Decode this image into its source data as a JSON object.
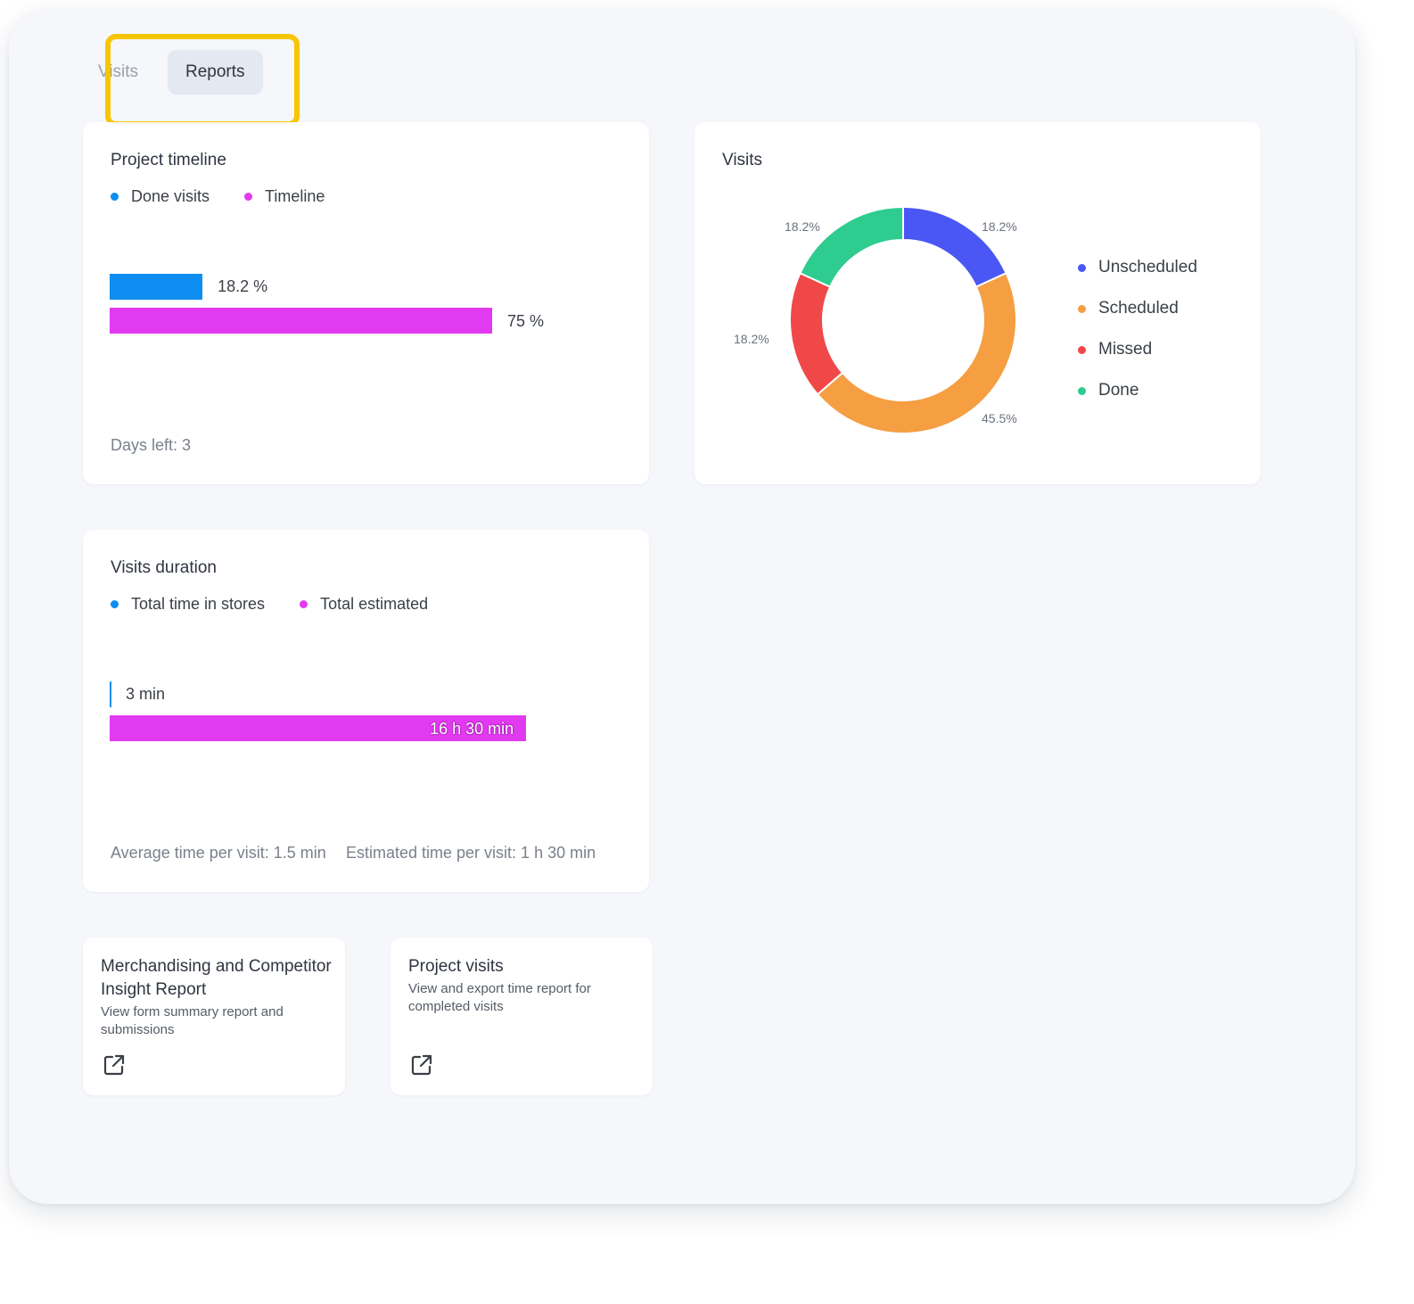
{
  "tabs": [
    {
      "label": "Visits",
      "active": false
    },
    {
      "label": "Reports",
      "active": true
    }
  ],
  "project_timeline": {
    "title": "Project timeline",
    "legend": [
      {
        "label": "Done visits",
        "color": "#0d8ef0"
      },
      {
        "label": "Timeline",
        "color": "#e23af0"
      }
    ],
    "bars": [
      {
        "label": "18.2 %",
        "value": 18.2,
        "color": "#0d8ef0"
      },
      {
        "label": "75 %",
        "value": 75,
        "color": "#e23af0"
      }
    ],
    "footer": "Days left: 3"
  },
  "visits": {
    "title": "Visits",
    "legend": [
      {
        "label": "Unscheduled",
        "color": "#4a57f5"
      },
      {
        "label": "Scheduled",
        "color": "#f59e42"
      },
      {
        "label": "Missed",
        "color": "#f04848"
      },
      {
        "label": "Done",
        "color": "#2ecc8f"
      }
    ]
  },
  "visits_duration": {
    "title": "Visits duration",
    "legend": [
      {
        "label": "Total time in stores",
        "color": "#0d8ef0"
      },
      {
        "label": "Total estimated",
        "color": "#e23af0"
      }
    ],
    "bars": [
      {
        "label": "3 min",
        "value": 3,
        "color": "#0d8ef0"
      },
      {
        "label": "16 h 30 min",
        "value": 990,
        "color": "#e23af0"
      }
    ],
    "footer_avg": "Average time per visit: 1.5 min",
    "footer_est": "Estimated time per visit: 1 h 30 min"
  },
  "reports": [
    {
      "title": "Merchandising and Competitor Insight Report",
      "description": "View form summary report and submissions",
      "icon": "external-link-icon"
    },
    {
      "title": "Project visits",
      "description": "View and export time report for completed visits",
      "icon": "external-link-icon"
    }
  ],
  "chart_data": [
    {
      "type": "bar",
      "orientation": "horizontal",
      "title": "Project timeline",
      "categories": [
        "Done visits",
        "Timeline"
      ],
      "values": [
        18.2,
        75
      ],
      "unit": "%",
      "xlim": [
        0,
        100
      ]
    },
    {
      "type": "pie",
      "donut": true,
      "title": "Visits",
      "labels": [
        "Unscheduled",
        "Scheduled",
        "Missed",
        "Done"
      ],
      "values": [
        18.2,
        45.5,
        18.2,
        18.2
      ],
      "value_labels": [
        "18.2%",
        "45.5%",
        "18.2%",
        "18.2%"
      ],
      "colors": [
        "#4a57f5",
        "#f59e42",
        "#f04848",
        "#2ecc8f"
      ],
      "legend_position": "right"
    },
    {
      "type": "bar",
      "orientation": "horizontal",
      "title": "Visits duration",
      "categories": [
        "Total time in stores",
        "Total estimated"
      ],
      "values": [
        3,
        990
      ],
      "value_labels": [
        "3 min",
        "16 h 30 min"
      ],
      "unit": "min",
      "xlim": [
        0,
        1100
      ]
    }
  ]
}
